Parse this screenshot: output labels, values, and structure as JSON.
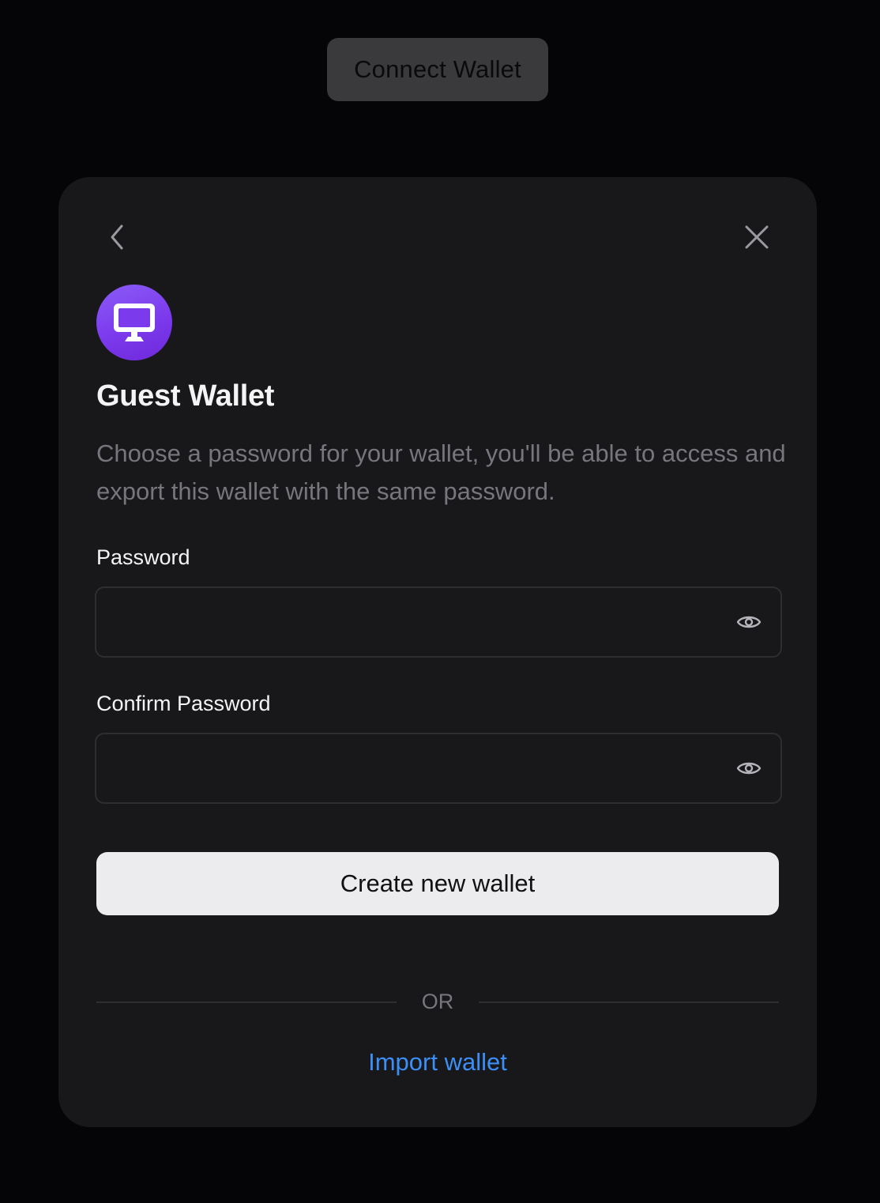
{
  "topbar": {
    "connect_label": "Connect Wallet"
  },
  "modal": {
    "back_icon": "chevron-left-icon",
    "close_icon": "close-icon",
    "wallet_icon": "monitor-icon",
    "title": "Guest Wallet",
    "description": "Choose a password for your wallet, you'll be able to access and export this wallet with the same password.",
    "password": {
      "label": "Password",
      "value": "",
      "icon": "eye-icon"
    },
    "confirm_password": {
      "label": "Confirm Password",
      "value": "",
      "icon": "eye-icon"
    },
    "create_label": "Create new wallet",
    "divider_text": "OR",
    "import_label": "Import wallet"
  },
  "colors": {
    "page_bg": "#050508",
    "modal_bg": "#18181b",
    "accent_purple": "#7c3aed",
    "link_blue": "#3b8ff6",
    "primary_button_bg": "#ececee",
    "muted_text": "#76767c"
  }
}
